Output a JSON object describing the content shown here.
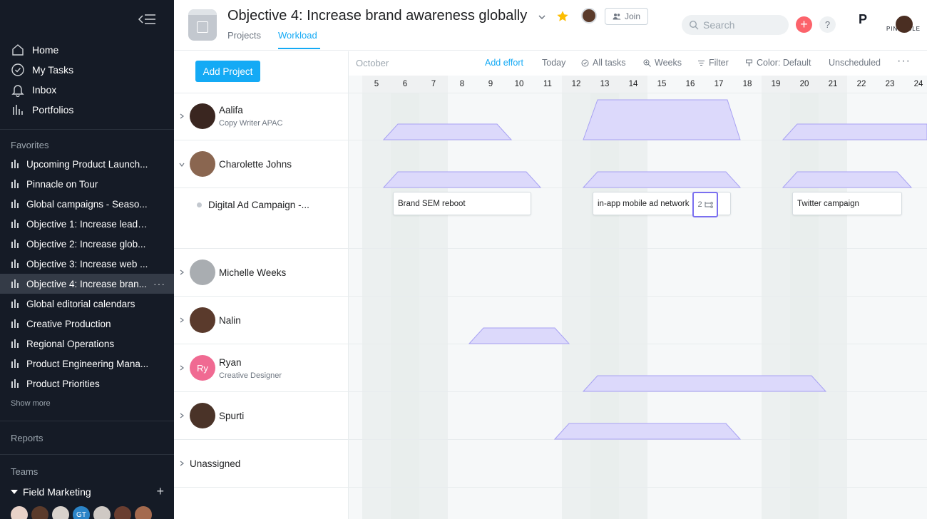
{
  "sidebar": {
    "nav": [
      {
        "label": "Home",
        "icon": "home-icon"
      },
      {
        "label": "My Tasks",
        "icon": "check-circle-icon"
      },
      {
        "label": "Inbox",
        "icon": "bell-icon"
      },
      {
        "label": "Portfolios",
        "icon": "bar-chart-icon"
      }
    ],
    "favorites_title": "Favorites",
    "favorites": [
      "Upcoming Product Launch...",
      "Pinnacle on Tour",
      "Global campaigns - Seaso...",
      "Objective 1: Increase leads...",
      "Objective 2: Increase glob...",
      "Objective 3: Increase web ...",
      "Objective 4: Increase bran...",
      "Global editorial calendars",
      "Creative Production",
      "Regional Operations",
      "Product Engineering Mana...",
      "Product Priorities"
    ],
    "active_favorite": 6,
    "more_dots": "···",
    "show_more": "Show more",
    "reports_title": "Reports",
    "teams_title": "Teams",
    "team_name": "Field Marketing",
    "team_add": "+",
    "team_member_initials": "GT"
  },
  "header": {
    "title": "Objective 4: Increase brand awareness globally",
    "tabs": [
      "Projects",
      "Workload"
    ],
    "active_tab": "Workload",
    "join_label": "Join",
    "search_placeholder": "Search",
    "plus_label": "+",
    "help_label": "?",
    "org_name": "PINNACLE",
    "org_mark": "P",
    "star_color": "#fcbd01",
    "accent_color": "#14aaf5"
  },
  "people_panel": {
    "add_project_label": "Add Project",
    "people": [
      {
        "name": "Aalifa",
        "role": "Copy Writer APAC",
        "expanded": false
      },
      {
        "name": "Charolette Johns",
        "role": "",
        "expanded": true
      },
      {
        "name": "Michelle Weeks",
        "role": "",
        "expanded": false
      },
      {
        "name": "Nalin",
        "role": "",
        "expanded": false
      },
      {
        "name": "Ryan",
        "role": "Creative Designer",
        "expanded": false,
        "initials": "Ry"
      },
      {
        "name": "Spurti",
        "role": "",
        "expanded": false
      }
    ],
    "project_row": "Digital Ad Campaign -...",
    "unassigned_label": "Unassigned"
  },
  "timeline": {
    "month": "October",
    "toolbar": [
      {
        "label": "Add effort",
        "icon": "",
        "accent": true
      },
      {
        "label": "Today",
        "icon": ""
      },
      {
        "label": "All tasks",
        "icon": "check-circle-icon"
      },
      {
        "label": "Weeks",
        "icon": "zoom-icon"
      },
      {
        "label": "Filter",
        "icon": "filter-icon"
      },
      {
        "label": "Color: Default",
        "icon": "paint-icon"
      },
      {
        "label": "Unscheduled",
        "icon": ""
      }
    ],
    "overflow": "···",
    "days": [
      5,
      6,
      7,
      8,
      9,
      10,
      11,
      12,
      13,
      14,
      15,
      16,
      17,
      18,
      19,
      20,
      21,
      22,
      23,
      24
    ],
    "weekend_days": [
      5,
      6,
      12,
      13,
      19,
      20
    ],
    "bar_color": "#dcd9fb",
    "bar_edge_color": "#a7a1f3",
    "tasks": [
      "Brand SEM reboot",
      "in-app mobile ad network",
      "Twitter campaign"
    ],
    "subtask_count": "2"
  }
}
